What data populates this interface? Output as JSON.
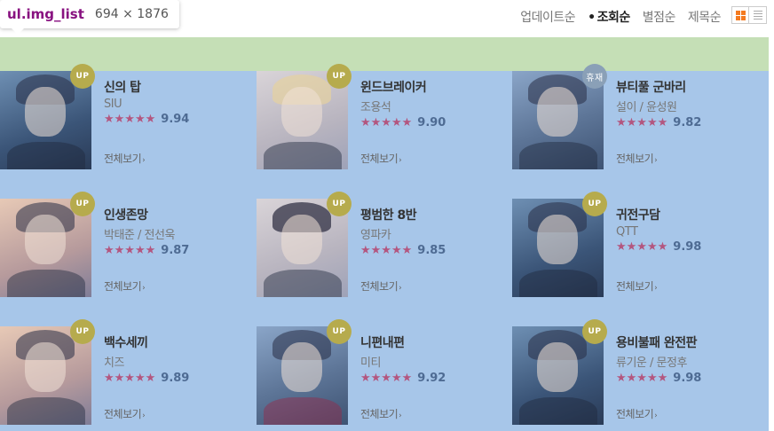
{
  "inspector": {
    "selector": "ul.img_list",
    "dimensions": "694 × 1876"
  },
  "sort": {
    "items": [
      {
        "label": "업데이트순",
        "active": false
      },
      {
        "label": "조회순",
        "active": true
      },
      {
        "label": "별점순",
        "active": false
      },
      {
        "label": "제목순",
        "active": false
      }
    ]
  },
  "colors": {
    "accent": "#f47a20",
    "margin_highlight": "#c5dfb6",
    "content_highlight": "#a7c6e9",
    "star": "#b3567f"
  },
  "list": {
    "items": [
      {
        "title": "신의 탑",
        "author": "SIU",
        "stars": "★★★★★",
        "score": "9.94",
        "badge": "UP",
        "more": "전체보기"
      },
      {
        "title": "윈드브레이커",
        "author": "조용석",
        "stars": "★★★★★",
        "score": "9.90",
        "badge": "UP",
        "more": "전체보기"
      },
      {
        "title": "뷰티풀 군바리",
        "author": "설이 / 윤성원",
        "stars": "★★★★★",
        "score": "9.82",
        "badge": "휴재",
        "more": "전체보기"
      },
      {
        "title": "인생존망",
        "author": "박태준 / 전선욱",
        "stars": "★★★★★",
        "score": "9.87",
        "badge": "UP",
        "more": "전체보기"
      },
      {
        "title": "평범한 8반",
        "author": "영파카",
        "stars": "★★★★★",
        "score": "9.85",
        "badge": "UP",
        "more": "전체보기"
      },
      {
        "title": "귀전구담",
        "author": "QTT",
        "stars": "★★★★★",
        "score": "9.98",
        "badge": "UP",
        "more": "전체보기"
      },
      {
        "title": "백수세끼",
        "author": "치즈",
        "stars": "★★★★★",
        "score": "9.89",
        "badge": "UP",
        "more": "전체보기"
      },
      {
        "title": "니편내편",
        "author": "미티",
        "stars": "★★★★★",
        "score": "9.92",
        "badge": "UP",
        "more": "전체보기"
      },
      {
        "title": "용비불패 완전판",
        "author": "류기운 / 문정후",
        "stars": "★★★★★",
        "score": "9.98",
        "badge": "UP",
        "more": "전체보기"
      }
    ]
  },
  "view_toggle": {
    "grid_icon": "grid-view-icon",
    "list_icon": "list-view-icon"
  }
}
